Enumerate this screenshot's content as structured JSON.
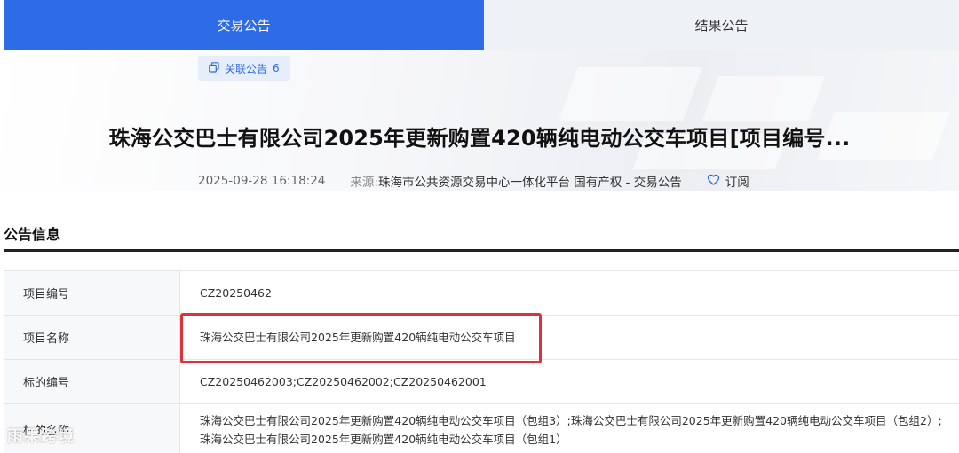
{
  "tabs": [
    {
      "label": "交易公告",
      "active": true
    },
    {
      "label": "结果公告",
      "active": false
    }
  ],
  "related": {
    "label": "关联公告",
    "count": "6"
  },
  "title": "珠海公交巴士有限公司2025年更新购置420辆纯电动公交车项目[项目编号...",
  "meta": {
    "datetime": "2025-09-28 16:18:24",
    "source_label": "来源:",
    "source": "珠海市公共资源交易中心一体化平台 国有产权 - 交易公告",
    "subscribe": "订阅"
  },
  "section": {
    "title": "公告信息"
  },
  "info_rows": [
    {
      "label": "项目编号",
      "value": "CZ20250462"
    },
    {
      "label": "项目名称",
      "value": "珠海公交巴士有限公司2025年更新购置420辆纯电动公交车项目"
    },
    {
      "label": "标的编号",
      "value": "CZ20250462003;CZ20250462002;CZ20250462001"
    },
    {
      "label": "标的名称",
      "value": "珠海公交巴士有限公司2025年更新购置420辆纯电动公交车项目（包组3）;珠海公交巴士有限公司2025年更新购置420辆纯电动公交车项目（包组2）;",
      "value2": "珠海公交巴士有限公司2025年更新购置420辆纯电动公交车项目（包组1）"
    }
  ],
  "watermark": "雨果跨境",
  "colors": {
    "accent": "#2e6be6",
    "highlight": "#e0303a"
  }
}
